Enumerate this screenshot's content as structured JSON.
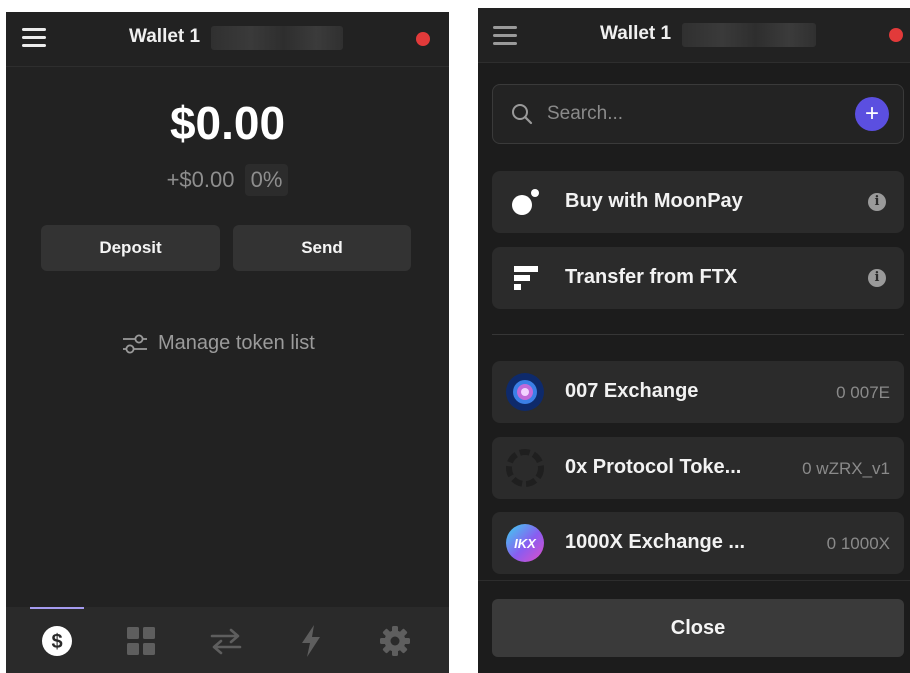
{
  "left_panel": {
    "wallet_title": "Wallet 1",
    "balance": "$0.00",
    "change_amount": "+$0.00",
    "change_percent": "0%",
    "deposit_label": "Deposit",
    "send_label": "Send",
    "manage_label": "Manage token list",
    "nav": {
      "active": "dollar",
      "icons": [
        "dollar-icon",
        "grid-icon",
        "swap-icon",
        "lightning-icon",
        "gear-icon"
      ],
      "indicator_color": "#a59bf0"
    },
    "status_color": "#e23a3a"
  },
  "right_panel": {
    "wallet_title": "Wallet 1",
    "search_placeholder": "Search...",
    "add_button_color": "#5b4fe0",
    "onramps": [
      {
        "label": "Buy with MoonPay",
        "icon": "moonpay-icon"
      },
      {
        "label": "Transfer from FTX",
        "icon": "ftx-icon"
      }
    ],
    "tokens": [
      {
        "name": "007 Exchange",
        "amount": "0 007E",
        "icon": "token-007-icon"
      },
      {
        "name": "0x Protocol Toke...",
        "amount": "0 wZRX_v1",
        "icon": "token-0x-icon"
      },
      {
        "name": "1000X Exchange ...",
        "amount": "0 1000X",
        "icon": "token-1000x-icon"
      }
    ],
    "close_label": "Close"
  }
}
